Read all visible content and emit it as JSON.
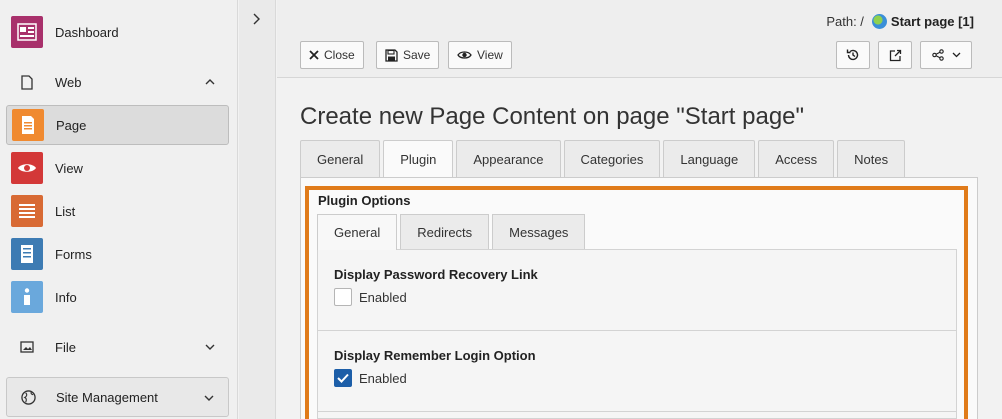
{
  "sidebar": {
    "modules": [
      {
        "label": "Dashboard",
        "icon": "dashboard-icon",
        "color": "#a8306b"
      },
      {
        "label": "Page",
        "icon": "page-icon",
        "color": "#f08a30"
      },
      {
        "label": "View",
        "icon": "view-icon",
        "color": "#d33838"
      },
      {
        "label": "List",
        "icon": "list-icon",
        "color": "#d86a34"
      },
      {
        "label": "Forms",
        "icon": "forms-icon",
        "color": "#3d7bb3"
      },
      {
        "label": "Info",
        "icon": "info-icon",
        "color": "#6aa8dc"
      }
    ],
    "groups": {
      "web": "Web",
      "file": "File",
      "site": "Site Management"
    }
  },
  "header": {
    "path_label": "Path: /",
    "path_page": "Start page [1]",
    "buttons": {
      "close": "Close",
      "save": "Save",
      "view": "View"
    }
  },
  "main": {
    "title": "Create new Page Content on page \"Start page\"",
    "tabs": [
      "General",
      "Plugin",
      "Appearance",
      "Categories",
      "Language",
      "Access",
      "Notes"
    ],
    "active_tab": "Plugin",
    "plugin": {
      "title": "Plugin Options",
      "subtabs": [
        "General",
        "Redirects",
        "Messages"
      ],
      "active_subtab": "General",
      "fields": [
        {
          "label": "Display Password Recovery Link",
          "option": "Enabled",
          "checked": false
        },
        {
          "label": "Display Remember Login Option",
          "option": "Enabled",
          "checked": true
        }
      ]
    }
  },
  "colors": {
    "highlight": "#e07b1a",
    "checkbox_checked": "#1c5ea8"
  }
}
